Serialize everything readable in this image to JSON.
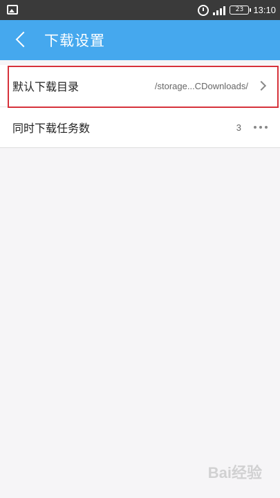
{
  "status_bar": {
    "time": "13:10",
    "battery": "23",
    "icons": [
      "gallery-icon",
      "alarm-icon",
      "signal-icon",
      "battery-icon"
    ]
  },
  "app_bar": {
    "title": "下载设置",
    "back_icon": "back-arrow-icon",
    "color": "#45a8ee"
  },
  "settings": {
    "download_dir": {
      "label": "默认下载目录",
      "value": "/storage...CDownloads/"
    },
    "concurrent_tasks": {
      "label": "同时下载任务数",
      "value": "3"
    }
  },
  "highlight_color": "#d6313a",
  "watermark": "Bai经验"
}
